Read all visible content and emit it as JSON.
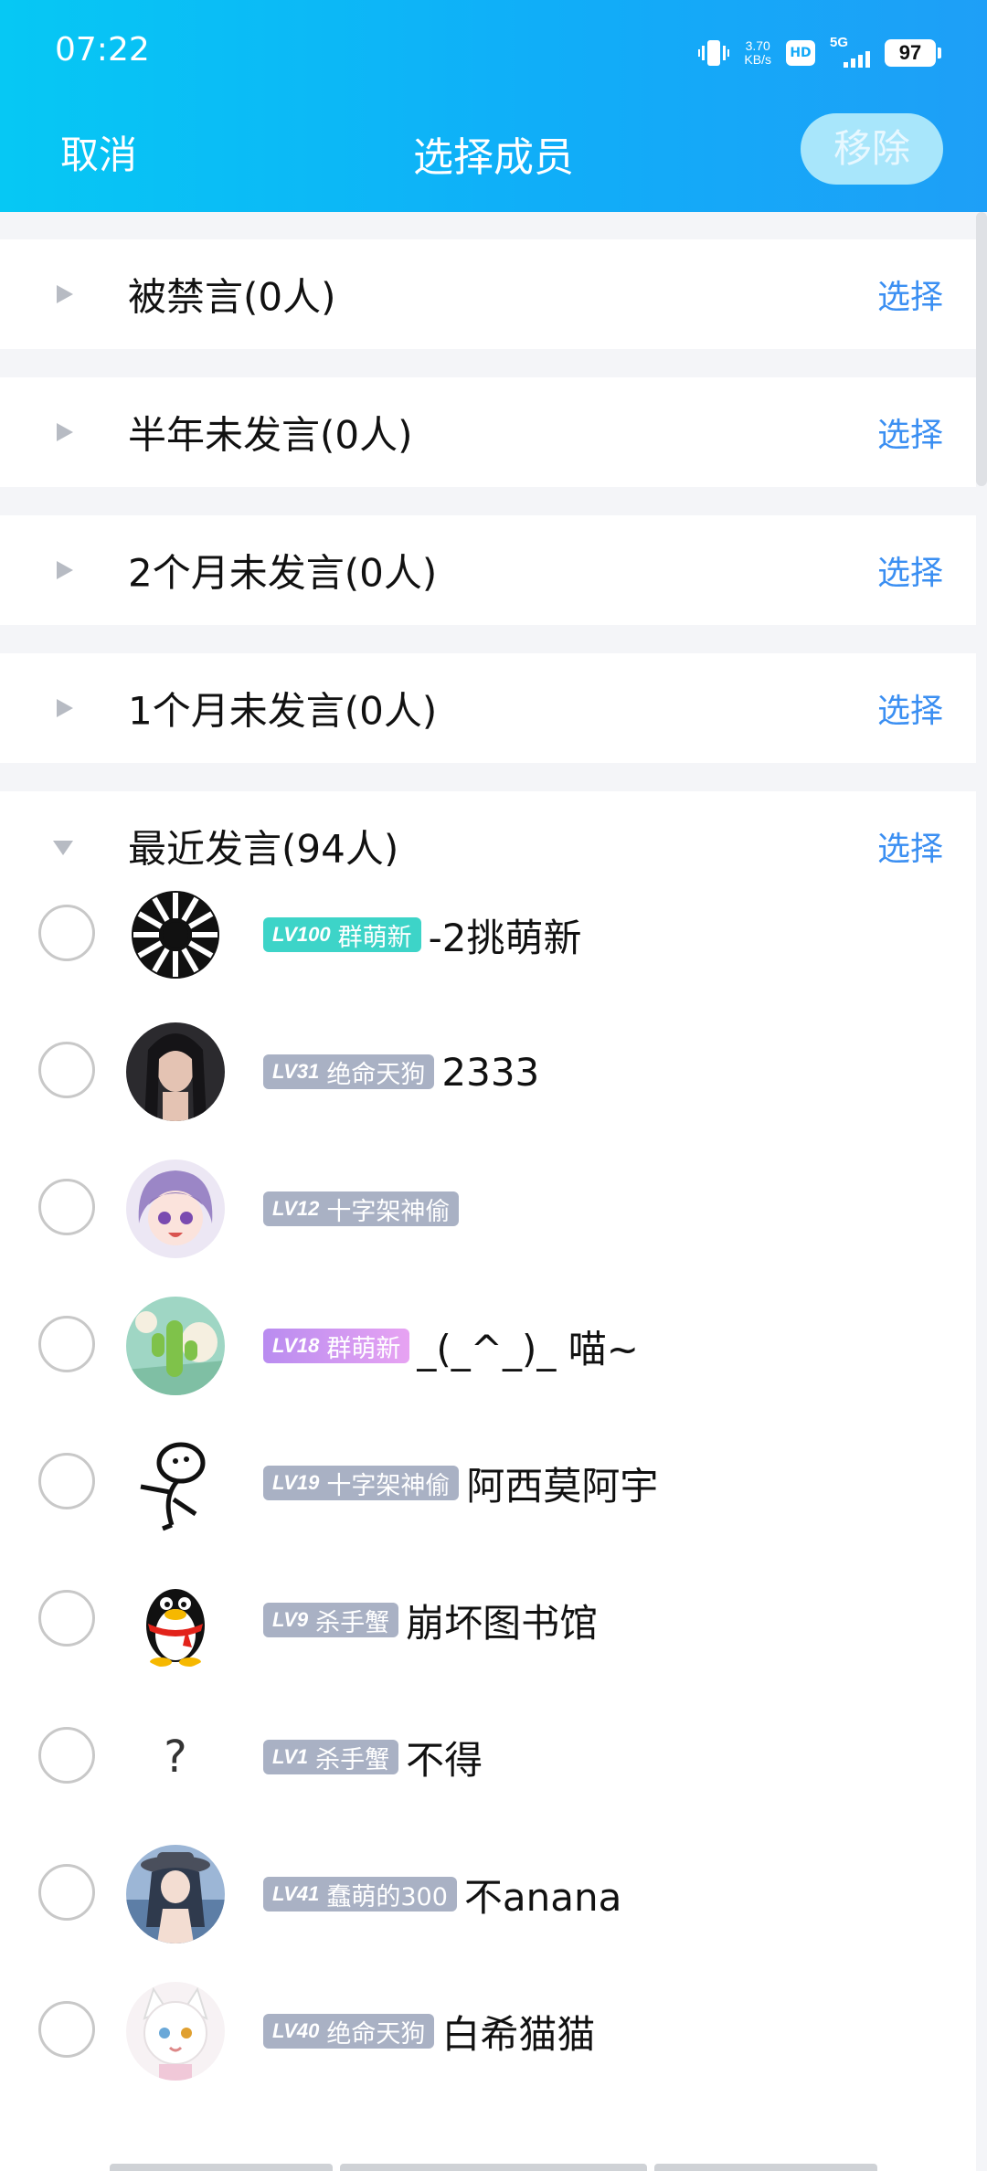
{
  "status_bar": {
    "time": "07:22",
    "speed_value": "3.70",
    "speed_unit": "KB/s",
    "hd": "HD",
    "network": "5G",
    "battery": "97"
  },
  "header": {
    "cancel_label": "取消",
    "title": "选择成员",
    "remove_label": "移除"
  },
  "groups": [
    {
      "name": "被禁言(0人)",
      "select_label": "选择",
      "expanded": false
    },
    {
      "name": "半年未发言(0人)",
      "select_label": "选择",
      "expanded": false
    },
    {
      "name": "2个月未发言(0人)",
      "select_label": "选择",
      "expanded": false
    },
    {
      "name": "1个月未发言(0人)",
      "select_label": "选择",
      "expanded": false
    },
    {
      "name": "最近发言(94人)",
      "select_label": "选择",
      "expanded": true
    }
  ],
  "members": [
    {
      "level": "LV100",
      "title": "群萌新",
      "name": "-2挑萌新",
      "badge_color": "#3dd4c8",
      "avatar": "sunburst-avatar"
    },
    {
      "level": "LV31",
      "title": "绝命天狗",
      "name": "2333",
      "badge_color": "#a9b1c4",
      "avatar": "dark-portrait-avatar"
    },
    {
      "level": "LV12",
      "title": "十字架神偷",
      "name": "",
      "badge_color": "#a9b1c4",
      "avatar": "anime-purple-hair-avatar"
    },
    {
      "level": "LV18",
      "title": "群萌新",
      "name": "_(_^_)_ 喵~",
      "badge_color": "#b98cf0",
      "avatar": "cartoon-cactus-avatar"
    },
    {
      "level": "LV19",
      "title": "十字架神偷",
      "name": "阿西莫阿宇",
      "badge_color": "#a9b1c4",
      "avatar": "stick-figure-avatar"
    },
    {
      "level": "LV9",
      "title": "杀手蟹",
      "name": "崩坏图书馆",
      "badge_color": "#a9b1c4",
      "avatar": "penguin-avatar"
    },
    {
      "level": "LV1",
      "title": "杀手蟹",
      "name": "不得",
      "badge_color": "#a9b1c4",
      "avatar": "question-mark-avatar",
      "avatar_text": "?"
    },
    {
      "level": "LV41",
      "title": "蠢萌的300",
      "name": "不anana",
      "badge_color": "#a9b1c4",
      "avatar": "anime-girl-hat-avatar"
    },
    {
      "level": "LV40",
      "title": "绝命天狗",
      "name": "白希猫猫",
      "badge_color": "#a9b1c4",
      "avatar": "anime-white-cat-avatar"
    }
  ]
}
